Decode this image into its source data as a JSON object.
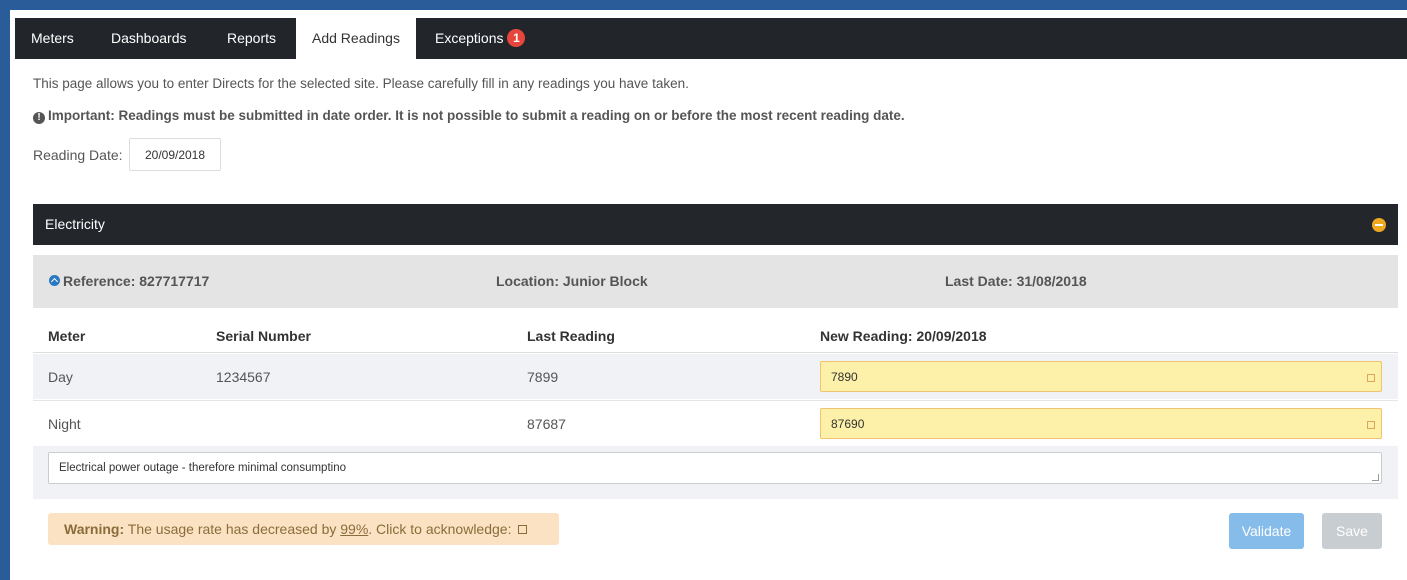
{
  "nav": {
    "tabs": [
      {
        "label": "Meters"
      },
      {
        "label": "Dashboards"
      },
      {
        "label": "Reports"
      },
      {
        "label": "Add Readings"
      },
      {
        "label": "Exceptions"
      }
    ],
    "exceptions_count": "1",
    "active_tab": "Add Readings"
  },
  "intro_text": "This page allows you to enter Directs for the selected site. Please carefully fill in any readings you have taken.",
  "important_text": "Important: Readings must be submitted in date order. It is not possible to submit a reading on or before the most recent reading date.",
  "reading_date": {
    "label": "Reading Date:",
    "value": "20/09/2018"
  },
  "panel": {
    "title": "Electricity",
    "reference": "Reference: 827717717",
    "location": "Location: Junior Block",
    "last_date": "Last Date: 31/08/2018",
    "columns": {
      "meter": "Meter",
      "serial": "Serial Number",
      "last": "Last Reading",
      "new": "New Reading: 20/09/2018"
    },
    "rows": [
      {
        "meter": "Day",
        "serial": "1234567",
        "last": "7899",
        "new": "7890"
      },
      {
        "meter": "Night",
        "serial": "",
        "last": "87687",
        "new": "87690"
      }
    ],
    "comment": "Electrical power outage - therefore minimal consumptino"
  },
  "warning": {
    "label": "Warning:",
    "text_before": "The usage rate has decreased by",
    "percent": "99%",
    "text_after": ". Click to acknowledge:"
  },
  "buttons": {
    "validate": "Validate",
    "save": "Save"
  },
  "colors": {
    "nav_bg": "#22262b",
    "frame": "#2a5c99",
    "input_warn_bg": "#fdf0a8",
    "warning_bg": "#fbe2c2",
    "validate": "#86bce9",
    "save": "#c8cdd2",
    "badge": "#e8453c",
    "collapse": "#f0a81f"
  },
  "icons": [
    "info-icon",
    "collapse-minus-icon",
    "chevron-up-circle-icon",
    "warning-square-icon",
    "resize-handle-icon",
    "checkbox-icon"
  ]
}
